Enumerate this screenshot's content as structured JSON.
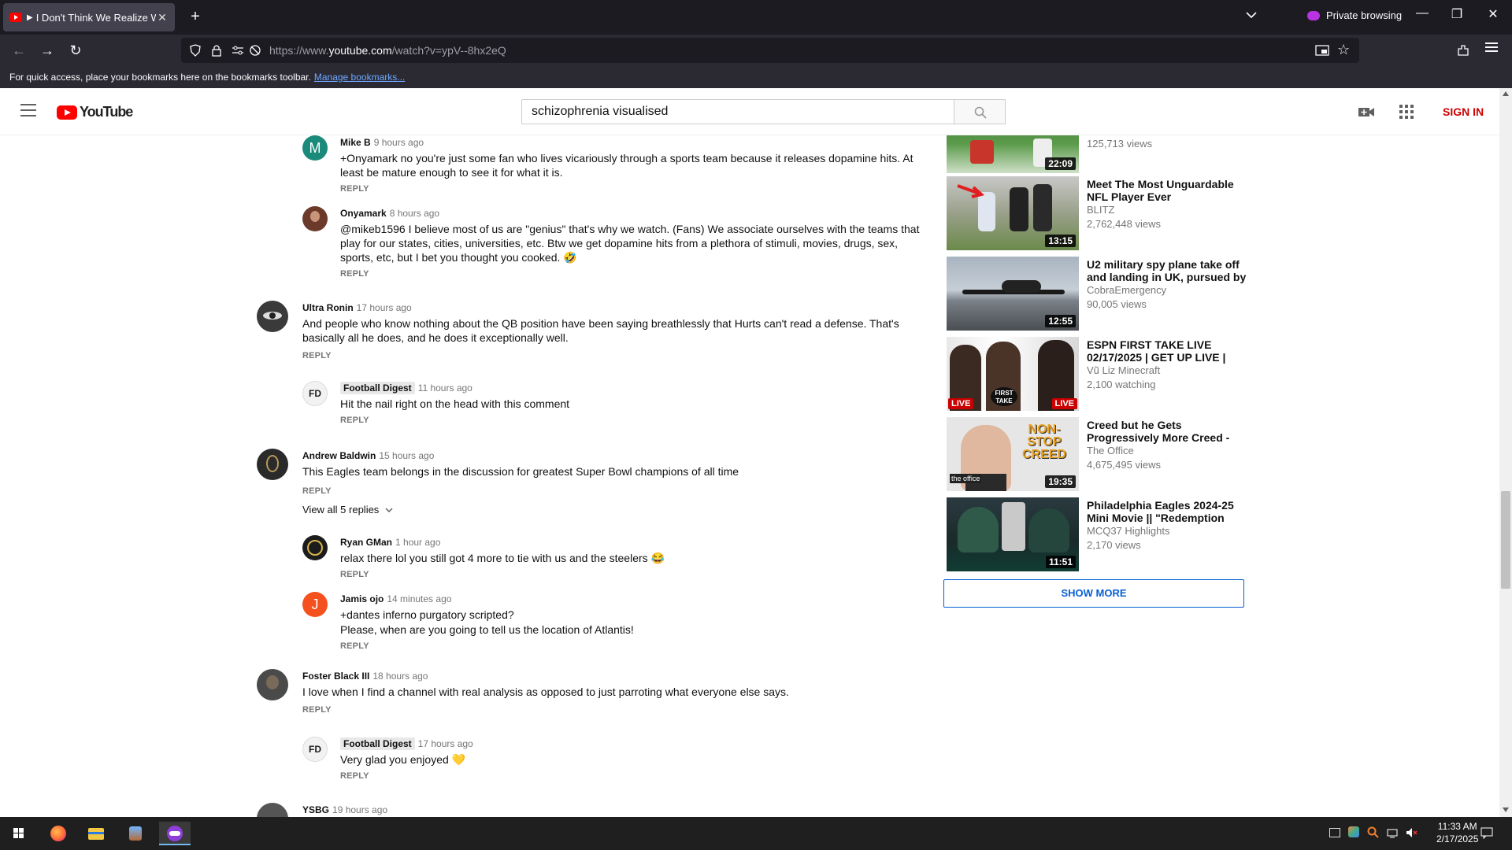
{
  "browser": {
    "tab_title": "I Don't Think We Realize Wh",
    "new_tab": "+",
    "private_label": "Private browsing",
    "url_prefix": "https://www.",
    "url_domain": "youtube.com",
    "url_path": "/watch?v=ypV--8hx2eQ",
    "bookmarks_text": "For quick access, place your bookmarks here on the bookmarks toolbar.",
    "bookmarks_link": "Manage bookmarks..."
  },
  "youtube": {
    "logo_text": "YouTube",
    "search_value": "schizophrenia visualised",
    "sign_in": "SIGN IN"
  },
  "comments": [
    {
      "author": "Mike B",
      "time": "9 hours ago",
      "text1": "+Onyamark no you're just some fan who lives vicariously through a sports team because it releases dopamine hits. At",
      "text2": "least be mature enough to see it for what it is.",
      "reply": "REPLY",
      "avatar_letter": "M"
    },
    {
      "author": "Onyamark",
      "time": "8 hours ago",
      "text1": "@mikeb1596  I believe most of us are \"genius\" that's why we watch. (Fans) We associate ourselves with the teams that",
      "text2": "play for our states, cities, universities, etc. Btw we get dopamine hits from a plethora of stimuli, movies, drugs, sex,",
      "text3": "sports, etc, but I bet you thought you cooked. 🤣",
      "reply": "REPLY"
    },
    {
      "author": "Ultra Ronin",
      "time": "17 hours ago",
      "text1": "And people who know nothing about the QB position have been saying breathlessly that Hurts can't read a defense. That's",
      "text2": "basically all he does, and he does it exceptionally well.",
      "reply": "REPLY"
    },
    {
      "author": "Football Digest",
      "time": "11 hours ago",
      "text1": "Hit the nail right on the head with this comment",
      "reply": "REPLY"
    },
    {
      "author": "Andrew Baldwin",
      "time": "15 hours ago",
      "text1": "This Eagles team belongs in the discussion for greatest Super Bowl champions of all time",
      "reply": "REPLY",
      "view_all": "View all 5 replies"
    },
    {
      "author": "Ryan GMan",
      "time": "1 hour ago",
      "text1": "relax there lol you still got 4 more to tie with us and the steelers 😂",
      "reply": "REPLY"
    },
    {
      "author": "Jamis ojo",
      "time": "14 minutes ago",
      "text1": "+dantes inferno purgatory scripted?",
      "text2": "Please, when are you going to tell us the location of Atlantis!",
      "reply": "REPLY",
      "avatar_letter": "J"
    },
    {
      "author": "Foster Black III",
      "time": "18 hours ago",
      "text1": "I love when I find a channel with real analysis as opposed to just parroting what everyone else says.",
      "reply": "REPLY"
    },
    {
      "author": "Football Digest",
      "time": "17 hours ago",
      "text1": "Very glad you enjoyed 💛",
      "reply": "REPLY"
    },
    {
      "author": "YSBG",
      "time": "19 hours ago"
    }
  ],
  "sidebar": [
    {
      "views": "125,713 views",
      "duration": "22:09"
    },
    {
      "title": "Meet The Most Unguardable NFL Player Ever",
      "channel": "BLITZ",
      "views": "2,762,448 views",
      "duration": "13:15"
    },
    {
      "title": "U2 military spy plane take off and landing in UK, pursued by",
      "channel": "CobraEmergency",
      "views": "90,005 views",
      "duration": "12:55"
    },
    {
      "title": "ESPN FIRST TAKE LIVE 02/17/2025 | GET UP LIVE |",
      "channel": "Vũ Liz Minecraft",
      "views": "2,100 watching",
      "live": "LIVE",
      "overlay": "FIRST TAKE"
    },
    {
      "title": "Creed but he Gets Progressively More Creed -",
      "channel": "The Office",
      "views": "4,675,495 views",
      "duration": "19:35",
      "overlay": "NON-STOP CREED",
      "brand": "the office"
    },
    {
      "title": "Philadelphia Eagles 2024-25 Mini Movie || \"Redemption",
      "channel": "MCQ37 Highlights",
      "views": "2,170 views",
      "duration": "11:51"
    }
  ],
  "show_more": "SHOW MORE",
  "taskbar": {
    "time": "11:33 AM",
    "date": "2/17/2025"
  },
  "colors": {
    "accent_red": "#cc0000",
    "link_blue": "#065fd4",
    "chrome_dark": "#1c1b22"
  }
}
